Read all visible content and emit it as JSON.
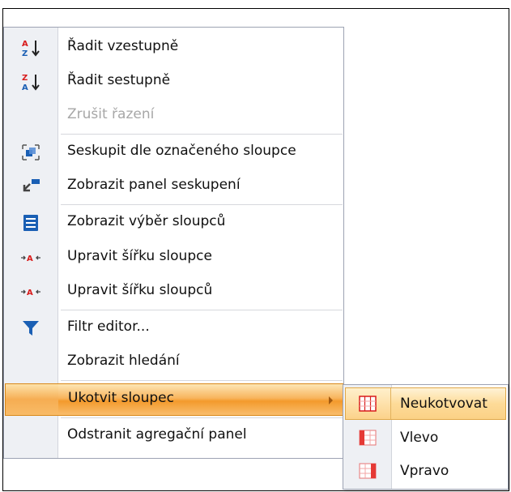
{
  "menu": {
    "items": [
      {
        "label": "Řadit vzestupně",
        "icon": "sort-ascending-icon"
      },
      {
        "label": "Řadit sestupně",
        "icon": "sort-descending-icon"
      },
      {
        "label": "Zrušit řazení",
        "disabled": true
      },
      {
        "label": "Seskupit dle označeného sloupce",
        "icon": "group-column-icon"
      },
      {
        "label": "Zobrazit panel seskupení",
        "icon": "group-panel-icon"
      },
      {
        "label": "Zobrazit výběr sloupců",
        "icon": "column-chooser-icon"
      },
      {
        "label": "Upravit šířku sloupce",
        "icon": "best-fit-icon"
      },
      {
        "label": "Upravit šířku sloupců",
        "icon": "best-fit-all-icon"
      },
      {
        "label": "Filtr editor...",
        "icon": "filter-icon"
      },
      {
        "label": "Zobrazit hledání"
      },
      {
        "label": "Ukotvit sloupec",
        "highlighted": true,
        "has_submenu": true
      },
      {
        "label": "Odstranit agregační panel"
      }
    ]
  },
  "submenu": {
    "items": [
      {
        "label": "Neukotvovat",
        "icon": "no-fix-icon",
        "highlighted": true
      },
      {
        "label": "Vlevo",
        "icon": "fix-left-icon"
      },
      {
        "label": "Vpravo",
        "icon": "fix-right-icon"
      }
    ]
  },
  "colors": {
    "accent_blue": "#1a5fb4",
    "highlight_orange": "#f39a2c",
    "submenu_highlight": "#fddb98",
    "icon_red": "#d81b1b"
  }
}
